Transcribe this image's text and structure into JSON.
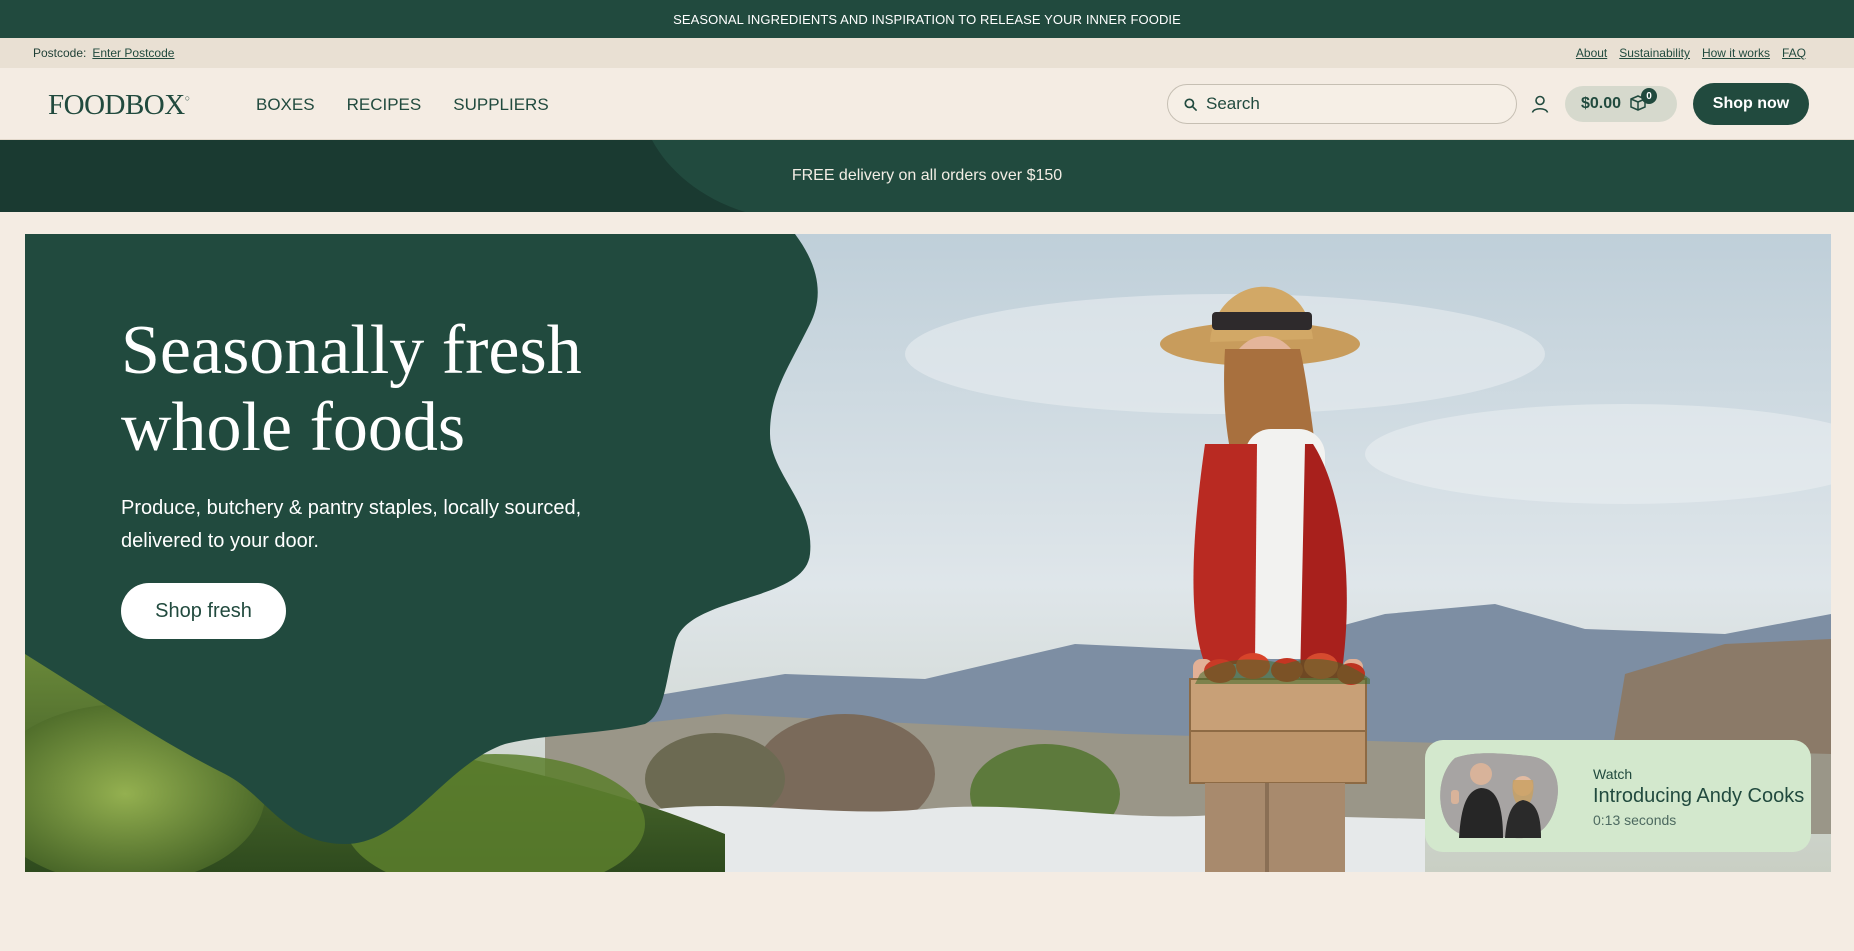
{
  "announcement": "SEASONAL INGREDIENTS AND INSPIRATION TO RELEASE YOUR INNER FOODIE",
  "utility": {
    "postcode_label": "Postcode:",
    "postcode_link": "Enter Postcode",
    "links": [
      "About",
      "Sustainability",
      "How it works",
      "FAQ"
    ]
  },
  "header": {
    "logo": "FOODBOX",
    "nav": [
      "BOXES",
      "RECIPES",
      "SUPPLIERS"
    ],
    "search_placeholder": "Search",
    "cart_total": "$0.00",
    "cart_count": "0",
    "shop_now": "Shop now"
  },
  "delivery_banner": "FREE delivery on all orders over $150",
  "hero": {
    "title_line1": "Seasonally fresh",
    "title_line2": "whole foods",
    "subtitle_line1": "Produce, butchery & pantry staples, locally sourced,",
    "subtitle_line2": "delivered to your door.",
    "cta": "Shop fresh"
  },
  "video": {
    "eyebrow": "Watch",
    "title": "Introducing Andy Cooks",
    "duration": "0:13 seconds"
  },
  "colors": {
    "brand_green": "#214a3e",
    "cream": "#f4ece3",
    "video_card": "#d3e8cd"
  }
}
